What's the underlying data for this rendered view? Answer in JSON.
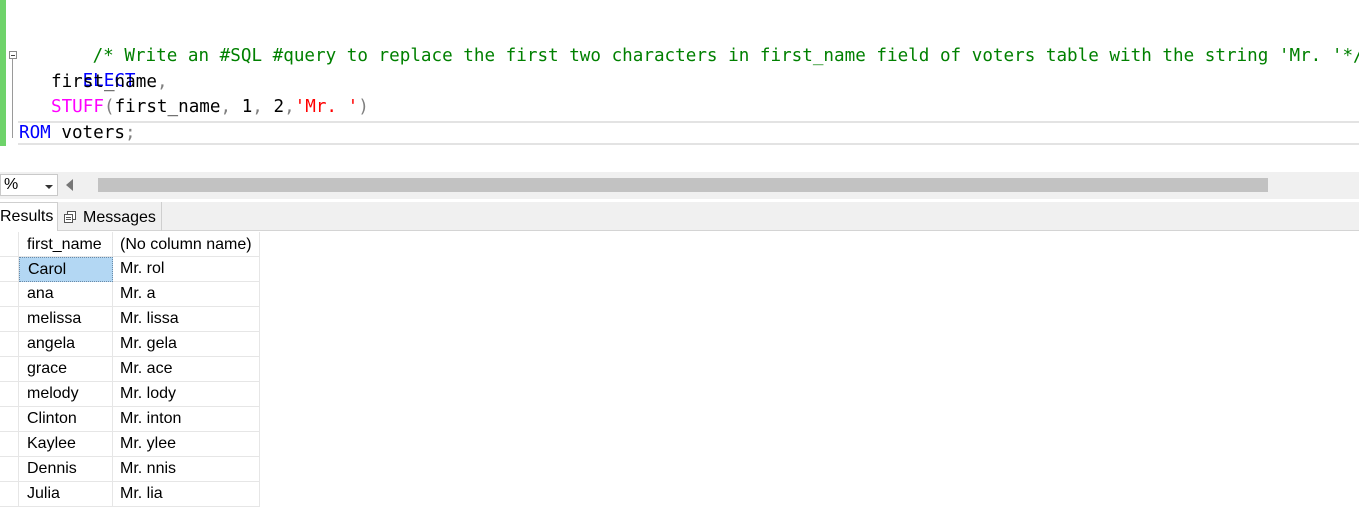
{
  "editor": {
    "comment_line": "/* Write an #SQL #query to replace the first two characters in first_name field of voters table with the string 'Mr. '*/",
    "select_keyword": "ELECT",
    "col1": "first_name",
    "col1_comma": ",",
    "func_name": "STUFF",
    "func_open": "(",
    "func_arg1": "first_name",
    "func_sep1": ", ",
    "func_arg2": "1",
    "func_sep2": ", ",
    "func_arg3": "2",
    "func_sep3": ",",
    "func_arg4": "'Mr. '",
    "func_close": ")",
    "from_keyword": "ROM",
    "table_name": " voters",
    "semicolon": ";"
  },
  "zoom": {
    "value": "%"
  },
  "tabs": {
    "results_label": "Results",
    "messages_label": "Messages"
  },
  "grid": {
    "headers": [
      "first_name",
      "(No column name)"
    ],
    "rows": [
      [
        "Carol",
        "Mr. rol"
      ],
      [
        "ana",
        "Mr. a"
      ],
      [
        "melissa",
        "Mr. lissa"
      ],
      [
        "angela",
        "Mr. gela"
      ],
      [
        "grace",
        "Mr. ace"
      ],
      [
        "melody",
        "Mr. lody"
      ],
      [
        "Clinton",
        "Mr. inton"
      ],
      [
        "Kaylee",
        "Mr. ylee"
      ],
      [
        "Dennis",
        "Mr. nnis"
      ],
      [
        "Julia",
        "Mr. lia"
      ]
    ]
  },
  "colors": {
    "comment": "#008000",
    "keyword": "#0000ff",
    "function": "#ff00ff",
    "string": "#ff0000",
    "selection": "#b3d7f3",
    "change_bar": "#6ed36a"
  }
}
